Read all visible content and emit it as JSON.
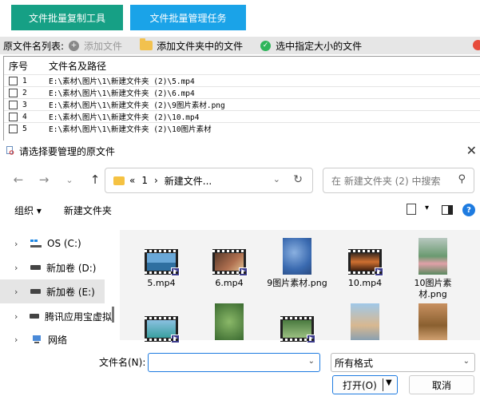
{
  "tabs": {
    "tab1": "文件批量复制工具",
    "tab2": "文件批量管理任务"
  },
  "toolbar": {
    "list_label": "原文件名列表:",
    "add_file": "添加文件",
    "add_folder_files": "添加文件夹中的文件",
    "select_size": "选中指定大小的文件"
  },
  "table": {
    "headers": [
      "序号",
      "文件名及路径"
    ],
    "rows": [
      {
        "num": "1",
        "path": "E:\\素材\\图片\\1\\新建文件夹 (2)\\5.mp4"
      },
      {
        "num": "2",
        "path": "E:\\素材\\图片\\1\\新建文件夹 (2)\\6.mp4"
      },
      {
        "num": "3",
        "path": "E:\\素材\\图片\\1\\新建文件夹 (2)\\9图片素材.png"
      },
      {
        "num": "4",
        "path": "E:\\素材\\图片\\1\\新建文件夹 (2)\\10.mp4"
      },
      {
        "num": "5",
        "path": "E:\\素材\\图片\\1\\新建文件夹 (2)\\10图片素材"
      }
    ]
  },
  "dialog": {
    "title": "请选择要管理的原文件",
    "address": {
      "prefix": "«",
      "seg1": "1",
      "sep": "›",
      "seg2": "新建文件..."
    },
    "search_placeholder": "在 新建文件夹 (2) 中搜索",
    "organize": "组织 ▾",
    "new_folder": "新建文件夹",
    "nav": [
      {
        "label": "OS (C:)",
        "selected": false
      },
      {
        "label": "新加卷 (D:)",
        "selected": false
      },
      {
        "label": "新加卷 (E:)",
        "selected": true
      },
      {
        "label": "腾讯应用宝虚拟",
        "selected": false
      },
      {
        "label": "网络",
        "selected": false
      }
    ],
    "files": [
      {
        "name": "5.mp4",
        "kind": "video"
      },
      {
        "name": "6.mp4",
        "kind": "video"
      },
      {
        "name": "9图片素材.png",
        "kind": "image"
      },
      {
        "name": "10.mp4",
        "kind": "video"
      },
      {
        "name": "10图片素材.png",
        "kind": "image"
      }
    ],
    "filename_label": "文件名(N):",
    "filename_value": "",
    "format": "所有格式",
    "open": "打开(O)",
    "cancel": "取消"
  }
}
